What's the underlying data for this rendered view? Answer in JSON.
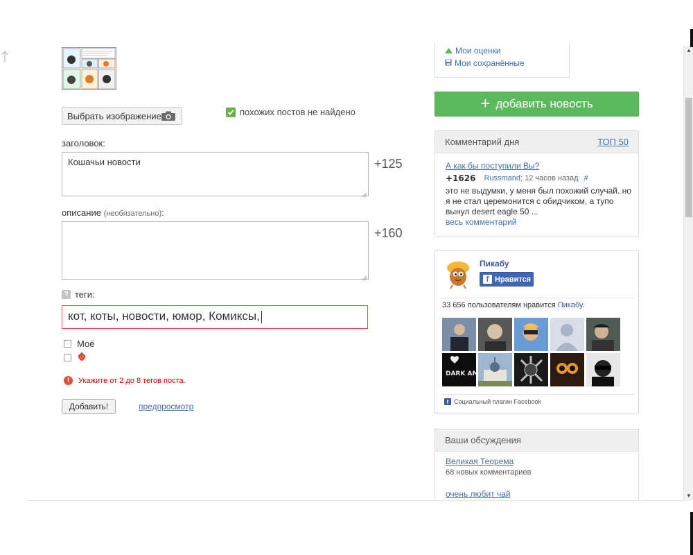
{
  "form": {
    "choose_image_label": "Выбрать изображение",
    "similar_posts": "похожих постов не найдено",
    "title_label": "заголовок:",
    "title_value": "Кошачьи новости",
    "title_counter": "+125",
    "desc_label": "описание",
    "desc_hint": "(необязательно)",
    "desc_colon": ":",
    "desc_value": "",
    "desc_counter": "+160",
    "tags_help": "?",
    "tags_label": "теги:",
    "tags_value": "кот, коты, новости, юмор, Комиксы,",
    "option_mine": "Моё",
    "error_text": "Укажите от 2 до 8 тегов поста.",
    "submit_label": "Добавить!",
    "preview_label": "предпросмотр"
  },
  "sidebar": {
    "my_ratings": "Мои оценки",
    "my_saved": "Мои сохранённые",
    "add_news": "добавить новость",
    "comment_day": {
      "heading": "Комментарий дня",
      "top_link": "ТОП 50",
      "post_title": "А как бы поступили Вы?",
      "score": "+1626",
      "author": "Russmand",
      "time": "; 12 часов назад",
      "hash": "#",
      "text": "это не выдумки, у меня был похожий случай. но я не стал церемонится с обидчиком, а тупо вынул desert eagle 50 ...",
      "full_link": "весь комментарий"
    },
    "facebook": {
      "page_name": "Пикабу",
      "like_label": "Нравится",
      "count_text": "33 656 пользователям нравится ",
      "count_link": "Пикабу",
      "count_dot": ".",
      "face_text": "DARK AMBIENT",
      "footer": "Социальный плагин Facebook"
    },
    "discussions": {
      "heading": "Ваши обсуждения",
      "item1_title": "Великая Теорема",
      "item1_sub": "68 новых комментариев",
      "item2_title": "очень любит чай"
    }
  },
  "colors": {
    "accent_green": "#5cb85c",
    "link_blue": "#3f72a8",
    "error_red": "#d00000",
    "facebook_blue": "#4267b2"
  }
}
